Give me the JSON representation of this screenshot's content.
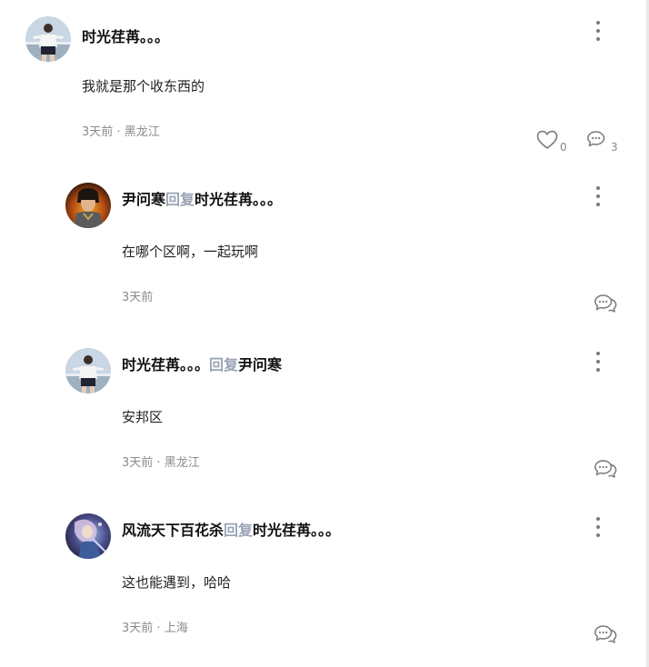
{
  "comments": [
    {
      "author": "时光荏苒。。。",
      "reply_word": "",
      "reply_to": "",
      "text": "我就是那个收东西的",
      "time": "3天前",
      "separator": " · ",
      "location": "黑龙江",
      "likes": "0",
      "replies": "3",
      "avatar_icon": "person-photo-avatar"
    },
    {
      "author": "尹问寒",
      "reply_word": "回复",
      "reply_to": "时光荏苒。。。",
      "text": "在哪个区啊，一起玩啊",
      "time": "3天前",
      "separator": "",
      "location": "",
      "avatar_icon": "game-warrior-avatar"
    },
    {
      "author": "时光荏苒。。。",
      "reply_word": "回复",
      "reply_to": "尹问寒",
      "text": "安邦区",
      "time": "3天前",
      "separator": " · ",
      "location": "黑龙江",
      "avatar_icon": "person-photo-avatar"
    },
    {
      "author": "风流天下百花杀",
      "reply_word": "回复",
      "reply_to": "时光荏苒。。。",
      "text": "这也能遇到，哈哈",
      "time": "3天前",
      "separator": " · ",
      "location": "上海",
      "avatar_icon": "fantasy-character-avatar"
    }
  ],
  "icons": {
    "more": "more-vertical-icon",
    "like": "heart-icon",
    "reply": "comment-bubbles-icon"
  },
  "colors": {
    "reply_word": "#9aa3b5",
    "meta": "#8a8a8a",
    "icon": "#7a7a7a"
  }
}
